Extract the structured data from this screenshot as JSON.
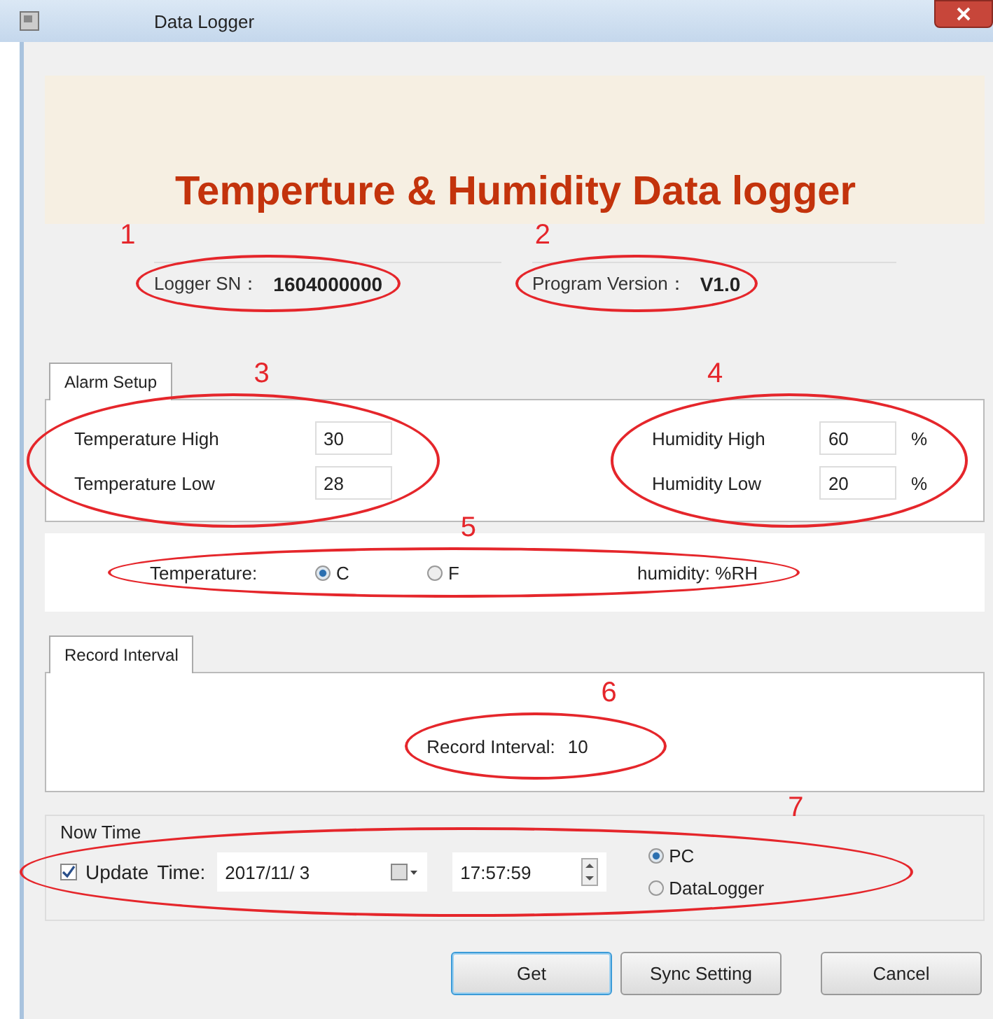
{
  "window": {
    "title": "Data Logger"
  },
  "banner": {
    "title": "Temperture & Humidity Data logger"
  },
  "info": [
    {
      "label": "Logger SN：",
      "value": "1604000000"
    },
    {
      "label": "Program Version：",
      "value": "V1.0"
    }
  ],
  "alarm_setup": {
    "tab": "Alarm Setup",
    "temperature": [
      {
        "label": "Temperature High",
        "value": "30"
      },
      {
        "label": "Temperature Low",
        "value": "28"
      }
    ],
    "humidity": [
      {
        "label": "Humidity High",
        "value": "60",
        "unit": "%"
      },
      {
        "label": "Humidity Low",
        "value": "20",
        "unit": "%"
      }
    ]
  },
  "units": {
    "label": "Temperature:",
    "options": [
      {
        "label": "C",
        "selected": true
      },
      {
        "label": "F",
        "selected": false
      }
    ],
    "humidity": "humidity: %RH"
  },
  "record_interval": {
    "tab": "Record Interval",
    "label": "Record Interval:",
    "value": "10"
  },
  "now_time": {
    "title": "Now Time",
    "update": {
      "label": "Update",
      "checked": true
    },
    "time_label": "Time:",
    "date": "2017/11/ 3",
    "time": "17:57:59",
    "sources": [
      {
        "label": "PC",
        "selected": true
      },
      {
        "label": "DataLogger",
        "selected": false
      }
    ]
  },
  "buttons": [
    {
      "label": "Get",
      "focused": true
    },
    {
      "label": "Sync Setting",
      "focused": false
    },
    {
      "label": "Cancel",
      "focused": false
    }
  ],
  "annotations": [
    {
      "number": "1"
    },
    {
      "number": "2"
    },
    {
      "number": "3"
    },
    {
      "number": "4"
    },
    {
      "number": "5"
    },
    {
      "number": "6"
    },
    {
      "number": "7"
    }
  ]
}
